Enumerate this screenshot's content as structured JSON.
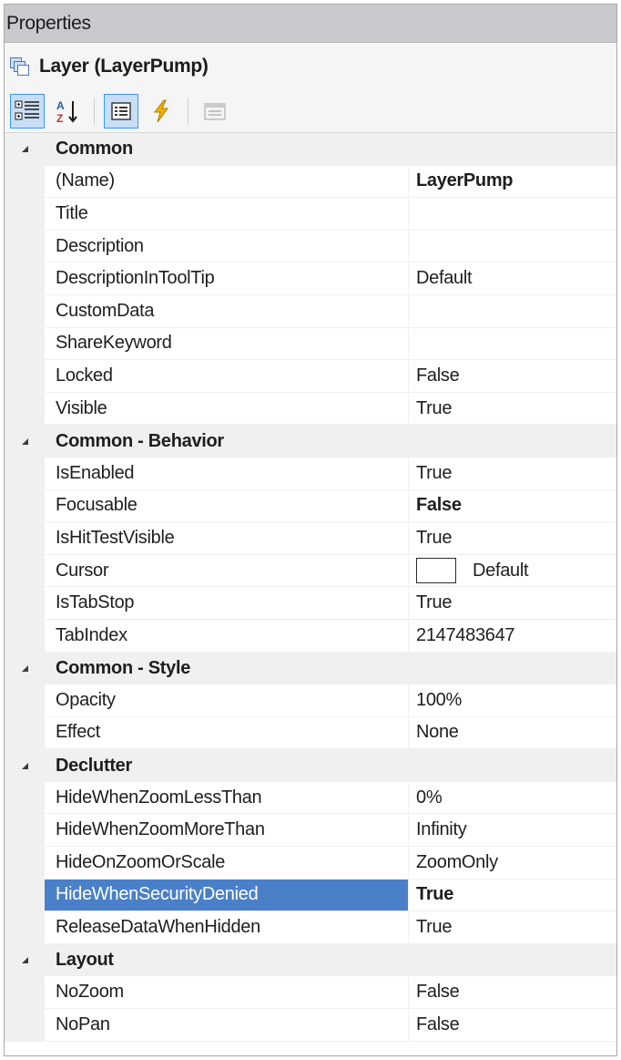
{
  "window": {
    "title": "Properties"
  },
  "header": {
    "type": "Layer",
    "name": "(LayerPump)"
  },
  "toolbar": {
    "buttons": [
      {
        "icon": "categorized-icon",
        "active": true
      },
      {
        "icon": "alphabetical-icon",
        "active": false
      },
      {
        "icon": "properties-icon",
        "active": true
      },
      {
        "icon": "events-lightning-icon",
        "active": false
      },
      {
        "icon": "property-pages-icon",
        "active": false,
        "disabled": true
      }
    ]
  },
  "categories": [
    {
      "label": "Common",
      "rows": [
        {
          "name": "(Name)",
          "value": "LayerPump",
          "bold": true
        },
        {
          "name": "Title",
          "value": ""
        },
        {
          "name": "Description",
          "value": ""
        },
        {
          "name": "DescriptionInToolTip",
          "value": "Default"
        },
        {
          "name": "CustomData",
          "value": ""
        },
        {
          "name": "ShareKeyword",
          "value": ""
        },
        {
          "name": "Locked",
          "value": "False"
        },
        {
          "name": "Visible",
          "value": "True"
        }
      ]
    },
    {
      "label": "Common - Behavior",
      "rows": [
        {
          "name": "IsEnabled",
          "value": "True"
        },
        {
          "name": "Focusable",
          "value": "False",
          "bold": true
        },
        {
          "name": "IsHitTestVisible",
          "value": "True"
        },
        {
          "name": "Cursor",
          "value": "Default",
          "swatch": true
        },
        {
          "name": "IsTabStop",
          "value": "True"
        },
        {
          "name": "TabIndex",
          "value": "2147483647"
        }
      ]
    },
    {
      "label": "Common - Style",
      "rows": [
        {
          "name": "Opacity",
          "value": "100%"
        },
        {
          "name": "Effect",
          "value": "None"
        }
      ]
    },
    {
      "label": "Declutter",
      "rows": [
        {
          "name": "HideWhenZoomLessThan",
          "value": "0%"
        },
        {
          "name": "HideWhenZoomMoreThan",
          "value": "Infinity"
        },
        {
          "name": "HideOnZoomOrScale",
          "value": "ZoomOnly"
        },
        {
          "name": "HideWhenSecurityDenied",
          "value": "True",
          "bold": true,
          "selected": true
        },
        {
          "name": "ReleaseDataWhenHidden",
          "value": "True"
        }
      ]
    },
    {
      "label": "Layout",
      "rows": [
        {
          "name": "NoZoom",
          "value": "False"
        },
        {
          "name": "NoPan",
          "value": "False"
        }
      ]
    }
  ],
  "colors": {
    "selection": "#4a80c8",
    "gutter": "#f0f0f0",
    "titlebar": "#c7c9cc"
  }
}
